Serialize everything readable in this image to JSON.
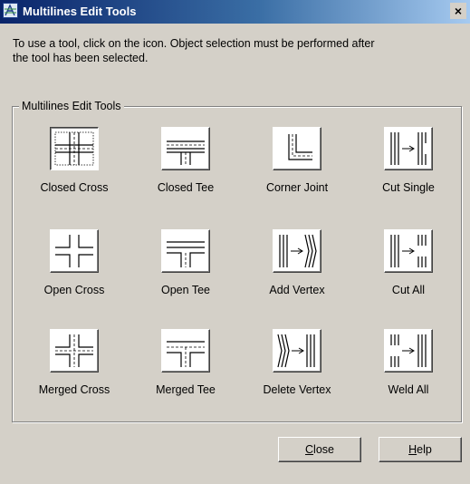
{
  "window": {
    "title": "Multilines Edit Tools",
    "close_glyph": "×",
    "icon": "multiline-app-icon"
  },
  "instructions": "To use a tool, click on the icon.  Object selection must be performed after\nthe tool has been selected.",
  "group": {
    "label": "Multilines Edit Tools",
    "tools": [
      {
        "label": "Closed Cross",
        "icon": "closed-cross-icon",
        "selected": true
      },
      {
        "label": "Closed Tee",
        "icon": "closed-tee-icon",
        "selected": false
      },
      {
        "label": "Corner Joint",
        "icon": "corner-joint-icon",
        "selected": false
      },
      {
        "label": "Cut Single",
        "icon": "cut-single-icon",
        "selected": false
      },
      {
        "label": "Open Cross",
        "icon": "open-cross-icon",
        "selected": false
      },
      {
        "label": "Open Tee",
        "icon": "open-tee-icon",
        "selected": false
      },
      {
        "label": "Add Vertex",
        "icon": "add-vertex-icon",
        "selected": false
      },
      {
        "label": "Cut All",
        "icon": "cut-all-icon",
        "selected": false
      },
      {
        "label": "Merged Cross",
        "icon": "merged-cross-icon",
        "selected": false
      },
      {
        "label": "Merged Tee",
        "icon": "merged-tee-icon",
        "selected": false
      },
      {
        "label": "Delete Vertex",
        "icon": "delete-vertex-icon",
        "selected": false
      },
      {
        "label": "Weld All",
        "icon": "weld-all-icon",
        "selected": false
      }
    ]
  },
  "buttons": {
    "close": {
      "mnemonic": "C",
      "rest": "lose"
    },
    "help": {
      "mnemonic": "H",
      "rest": "elp"
    }
  }
}
